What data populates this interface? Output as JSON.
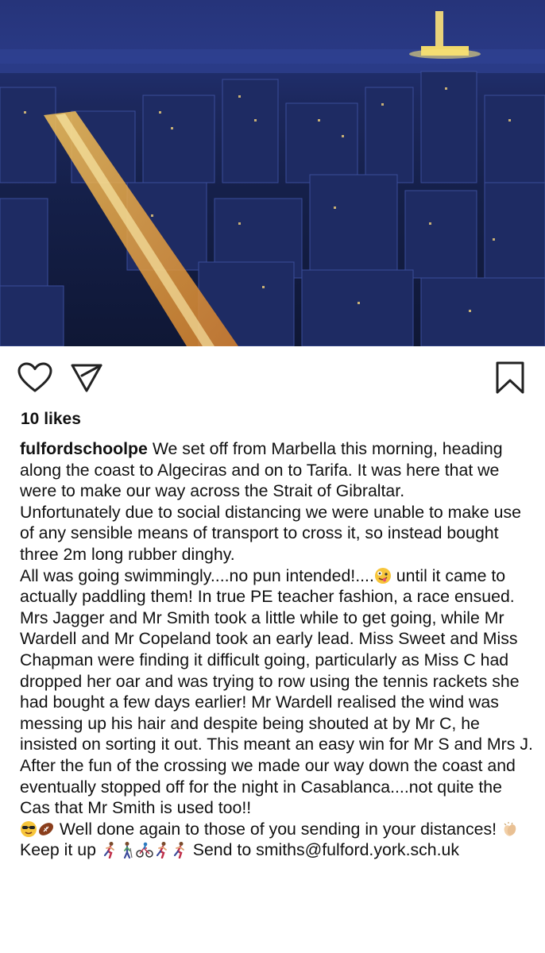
{
  "post": {
    "image": {
      "description_icon": "city-night-photo"
    },
    "actions": {
      "like_icon": "heart-outline-icon",
      "share_icon": "paper-plane-icon",
      "save_icon": "bookmark-outline-icon"
    },
    "likes_text": "10 likes",
    "caption": {
      "username": "fulfordschoolpe",
      "paragraphs": {
        "p1": " We set off from Marbella this morning, heading along the coast to Algeciras and on to Tarifa. It was here that we were to make our way across the Strait of Gibraltar.",
        "p2": "Unfortunately due to social distancing we were unable to make use of any sensible means of transport to cross it, so instead bought three 2m long rubber dinghy.",
        "p3a": "All was going swimmingly....no pun intended!....",
        "p3b": " until it came to actually paddling them! In true PE teacher fashion, a race ensued. Mrs Jagger and Mr Smith took a little while to get going, while Mr Wardell and Mr Copeland took an early lead. Miss Sweet and Miss Chapman were finding it difficult going, particularly as Miss C had dropped her oar and was trying to row using the tennis rackets she had bought a few days earlier! Mr Wardell realised the wind was messing up his hair and despite being shouted at by Mr C, he insisted on sorting it out. This meant an easy win for Mr S and Mrs J.",
        "p4a": "After the fun of the crossing we made our way down the coast and eventually stopped off for the night in Casablanca....not quite the Cas that Mr Smith is used too!!",
        "p4b": " Well done again to those of you sending in your distances! ",
        "p4c": " Keep it up ",
        "p4d": " Send to smiths@fulford.york.sch.uk"
      }
    },
    "emoji_names": [
      "zany-face-icon",
      "sunglasses-face-icon",
      "american-football-icon",
      "clapping-hands-icon",
      "runner-icon",
      "walker-icon",
      "cyclist-icon",
      "runner-icon",
      "runner-icon"
    ],
    "colors": {
      "text": "#111111",
      "icon": "#222222",
      "background": "#ffffff"
    }
  }
}
